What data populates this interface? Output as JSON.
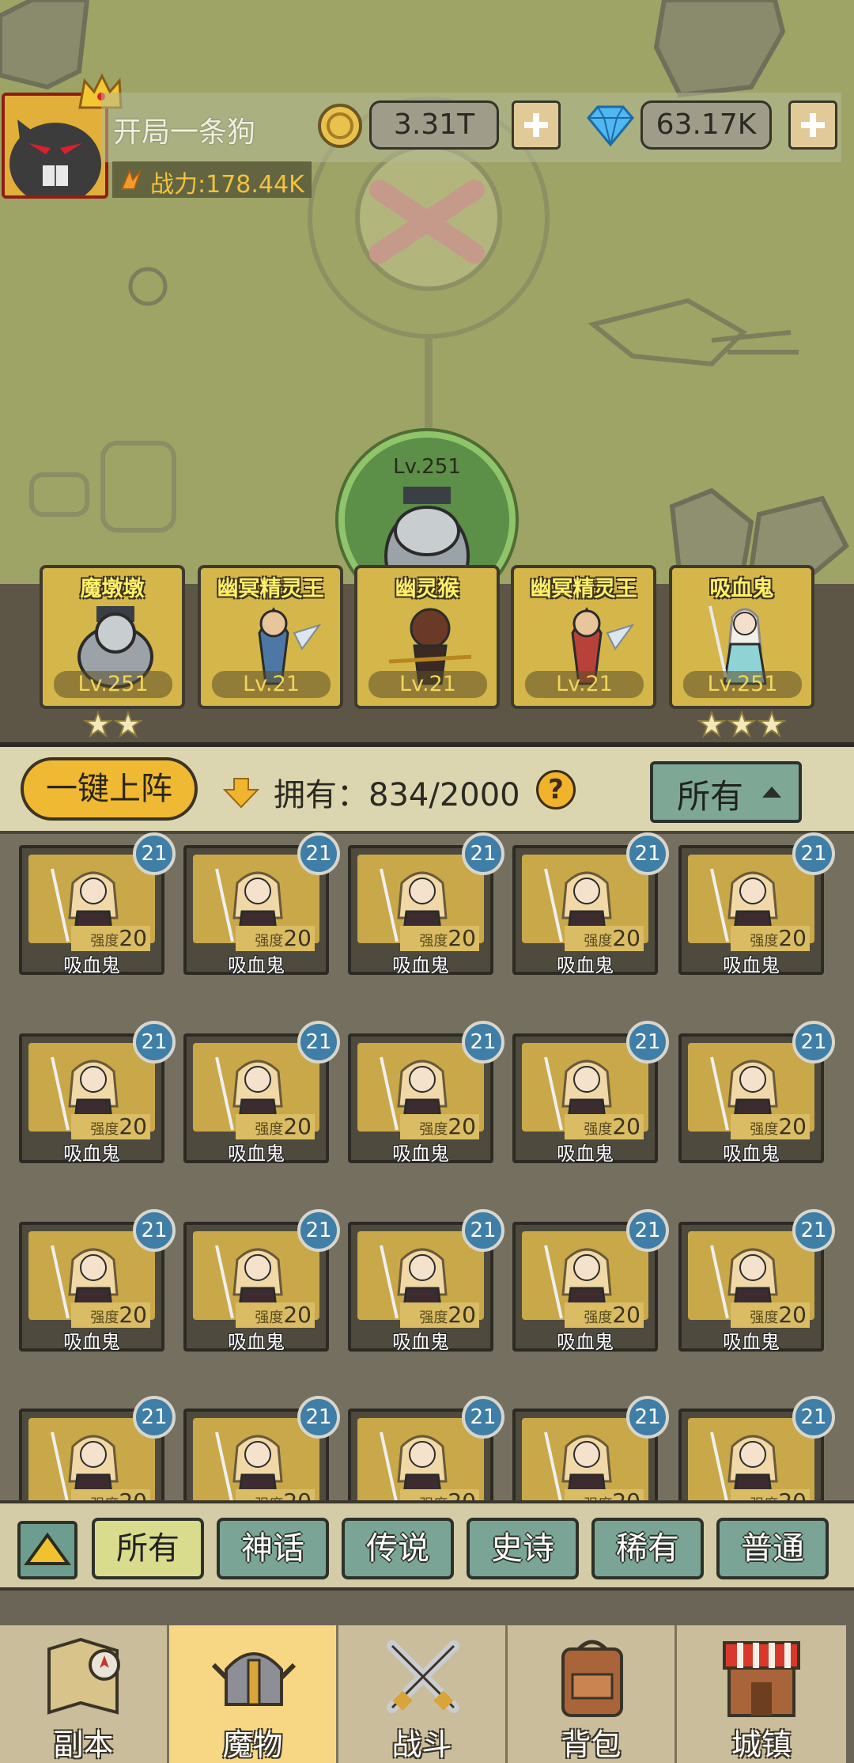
{
  "header": {
    "player_name": "开局一条狗",
    "power": "战力:178.44K",
    "coins": "3.31T",
    "gems": "63.17K"
  },
  "leader": {
    "level": "Lv.251"
  },
  "lineup": [
    {
      "name": "魔墩墩",
      "level": "Lv.251",
      "stars": 2
    },
    {
      "name": "幽冥精灵王",
      "level": "Lv.21",
      "stars": 0
    },
    {
      "name": "幽灵猴",
      "level": "Lv.21",
      "stars": 0
    },
    {
      "name": "幽冥精灵王",
      "level": "Lv.21",
      "stars": 0
    },
    {
      "name": "吸血鬼",
      "level": "Lv.251",
      "stars": 3
    }
  ],
  "controls": {
    "auto_deploy": "一键上阵",
    "owned": "拥有：834/2000",
    "help": "?",
    "filter": "所有"
  },
  "monster_card": {
    "name": "吸血鬼",
    "strength_label": "强度",
    "strength": "20",
    "level": "21"
  },
  "grid": {
    "rows": 4,
    "cols": 5
  },
  "rarity_tabs": [
    "所有",
    "神话",
    "传说",
    "史诗",
    "稀有",
    "普通"
  ],
  "nav": [
    {
      "label": "副本",
      "icon": "map-icon"
    },
    {
      "label": "魔物",
      "icon": "monster-helmet-icon"
    },
    {
      "label": "战斗",
      "icon": "crossed-swords-icon"
    },
    {
      "label": "背包",
      "icon": "backpack-icon"
    },
    {
      "label": "城镇",
      "icon": "shop-icon"
    }
  ],
  "colors": {
    "accent": "#efb933",
    "teal": "#7aa596",
    "map_green": "#9ea465",
    "active_tab": "#f7d783"
  }
}
